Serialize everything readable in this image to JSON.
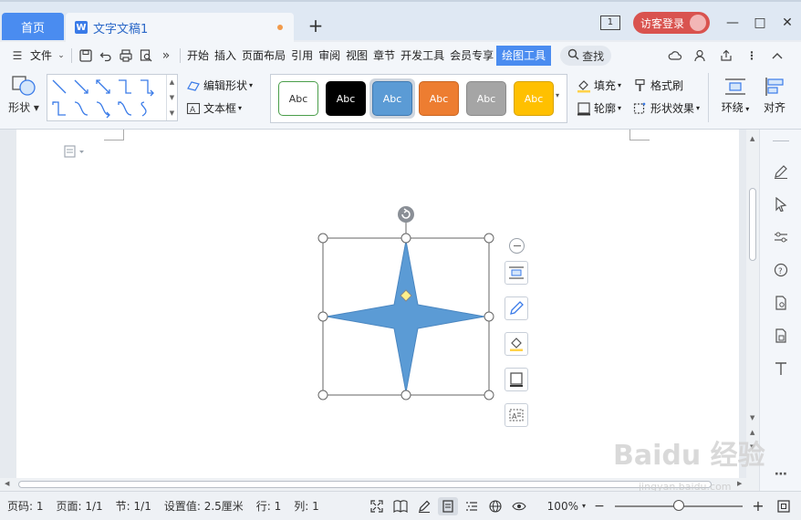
{
  "titlebar": {
    "home_tab": "首页",
    "doc_tab": "文字文稿1",
    "doc_icon": "W",
    "new_tab": "+",
    "page_count_label": "1",
    "login_label": "访客登录"
  },
  "menubar": {
    "file_label": "文件",
    "items": [
      "开始",
      "插入",
      "页面布局",
      "引用",
      "审阅",
      "视图",
      "章节",
      "开发工具",
      "会员专享",
      "绘图工具"
    ],
    "search_label": "查找"
  },
  "ribbon": {
    "shape_label": "形状",
    "edit_shape_label": "编辑形状",
    "textbox_label": "文本框",
    "styles": [
      {
        "label": "Abc",
        "bg": "#ffffff",
        "fg": "#333333",
        "border": "#4a9e4a"
      },
      {
        "label": "Abc",
        "bg": "#000000",
        "fg": "#ffffff",
        "border": "#000000"
      },
      {
        "label": "Abc",
        "bg": "#5b9bd5",
        "fg": "#ffffff",
        "border": "#3f79b0"
      },
      {
        "label": "Abc",
        "bg": "#ed7d31",
        "fg": "#ffffff",
        "border": "#c96522"
      },
      {
        "label": "Abc",
        "bg": "#a5a5a5",
        "fg": "#ffffff",
        "border": "#8a8a8a"
      },
      {
        "label": "Abc",
        "bg": "#ffc000",
        "fg": "#ffffff",
        "border": "#d6a200"
      }
    ],
    "fill_label": "填充",
    "outline_label": "轮廓",
    "format_painter_label": "格式刷",
    "shape_effect_label": "形状效果",
    "wrap_label": "环绕",
    "align_label": "对齐"
  },
  "canvas": {
    "shape_name": "four-point-star",
    "shape_color": "#5b9bd5"
  },
  "statusbar": {
    "page_no": "页码: 1",
    "pages": "页面: 1/1",
    "section": "节: 1/1",
    "setting": "设置值: 2.5厘米",
    "row": "行: 1",
    "col": "列: 1",
    "zoom": "100%"
  },
  "watermark": {
    "text": "Baidu 经验",
    "sub": "jingyan.baidu.com"
  }
}
